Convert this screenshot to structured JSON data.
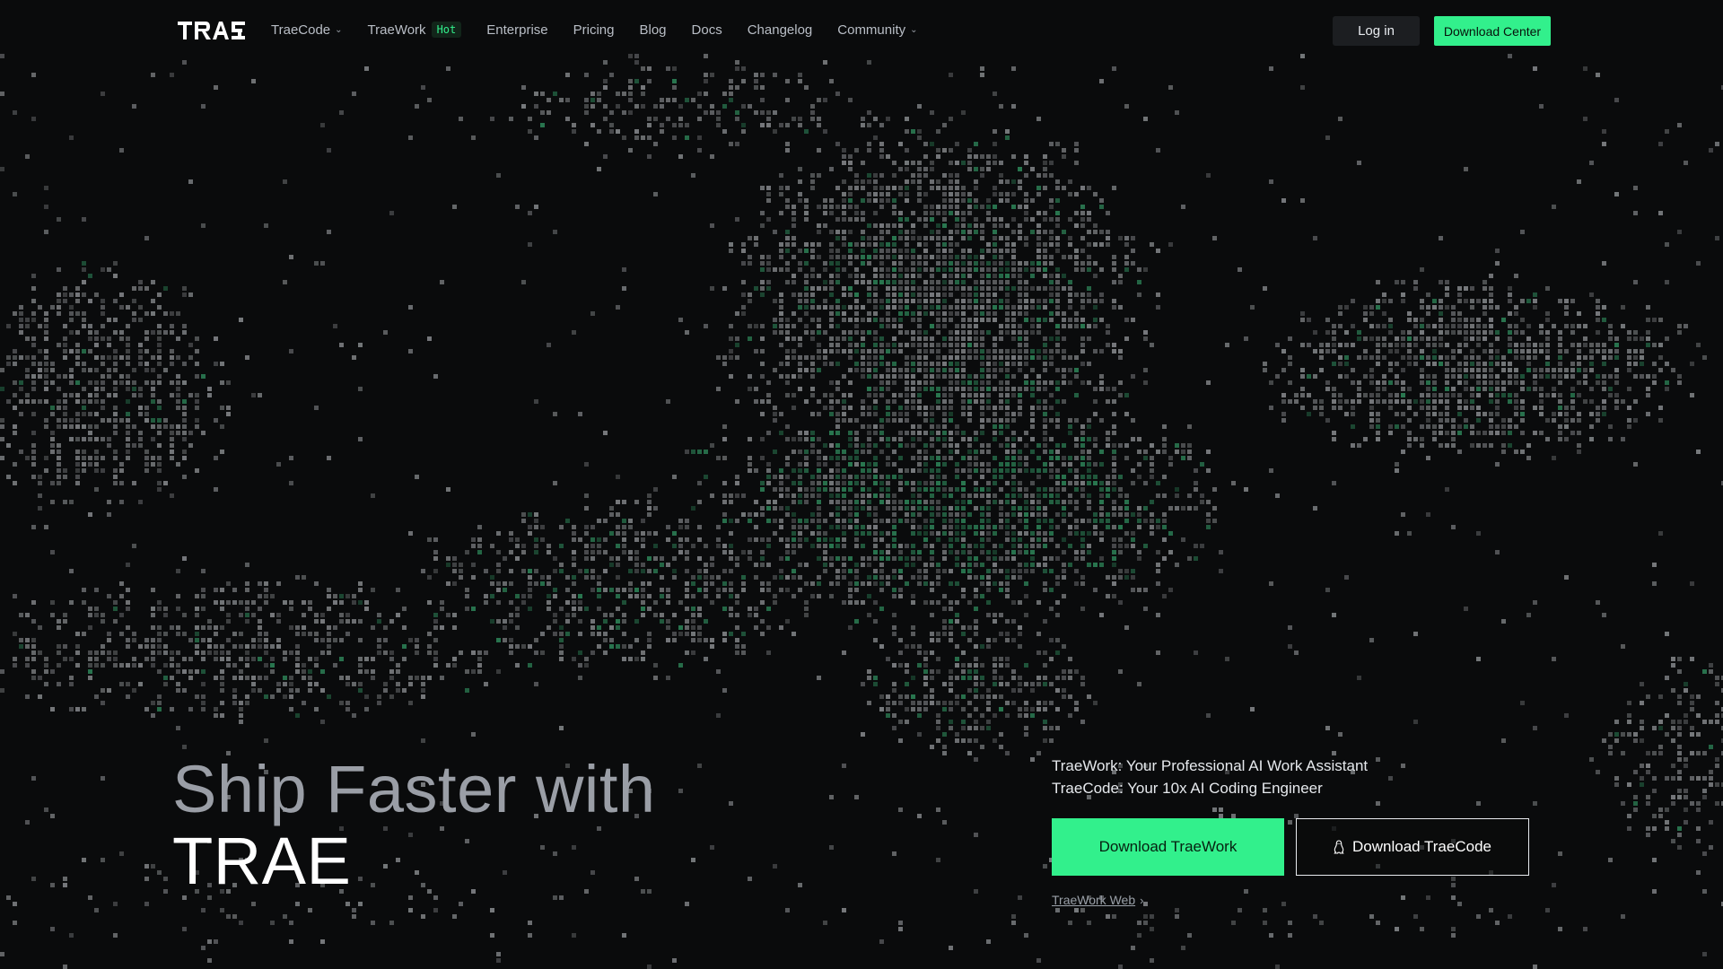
{
  "brand": {
    "logo_text": "TRAE"
  },
  "nav": {
    "items": [
      {
        "label": "TraeCode",
        "has_dropdown": true
      },
      {
        "label": "TraeWork",
        "badge": "Hot"
      },
      {
        "label": "Enterprise"
      },
      {
        "label": "Pricing"
      },
      {
        "label": "Blog"
      },
      {
        "label": "Docs"
      },
      {
        "label": "Changelog"
      },
      {
        "label": "Community",
        "has_dropdown": true
      }
    ],
    "login_label": "Log in",
    "download_center_label": "Download Center"
  },
  "hero": {
    "title_line1": "Ship Faster with",
    "title_line2": "TRAE",
    "tagline1": "TraeWork: Your Professional AI Work Assistant",
    "tagline2": "TraeCode: Your 10x AI Coding Engineer",
    "primary_button": "Download TraeWork",
    "secondary_button": "Download TraeCode",
    "secondary_icon": "linux-penguin-icon",
    "web_link": "TraeWork Web",
    "web_link_icon": "chevron-right-icon"
  },
  "colors": {
    "background": "#0a0b0c",
    "accent": "#32f08c",
    "pixel_gray": "#8a8d90",
    "pixel_green": "#2f8a5c"
  }
}
